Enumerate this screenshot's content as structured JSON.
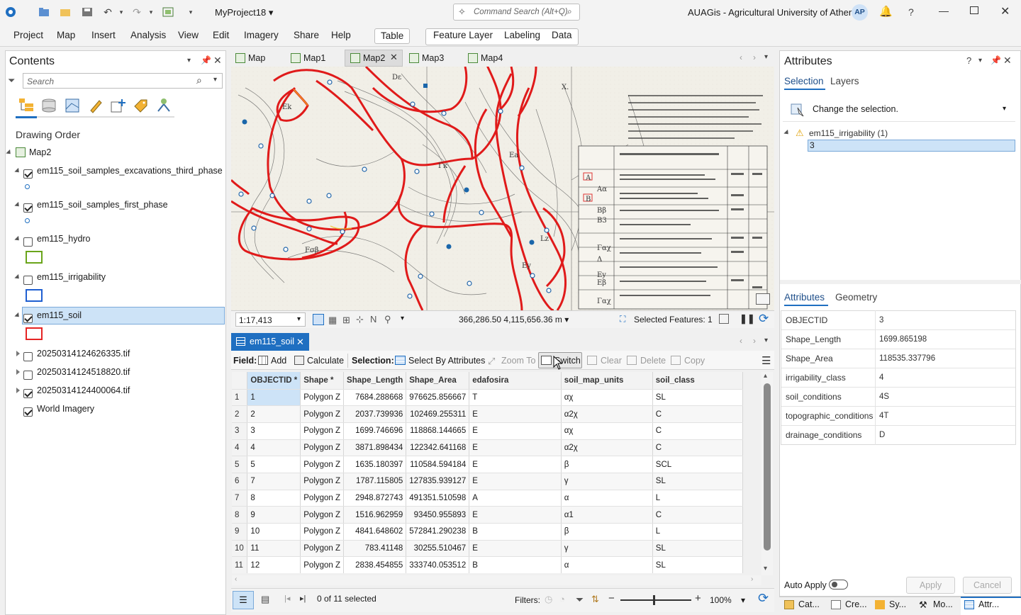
{
  "titlebar": {
    "project": "MyProject18",
    "command_search_placeholder": "Command Search (Alt+Q)",
    "org": "AUAGis - Agricultural University of Athens",
    "avatar": "AP"
  },
  "ribbon": {
    "tabs": [
      "Project",
      "Map",
      "Insert",
      "Analysis",
      "View",
      "Edit",
      "Imagery",
      "Share",
      "Help"
    ],
    "table_tab": "Table",
    "context_tabs": [
      "Feature Layer",
      "Labeling",
      "Data"
    ]
  },
  "contents": {
    "title": "Contents",
    "search_placeholder": "Search",
    "drawing_order": "Drawing Order",
    "map_name": "Map2",
    "layers": [
      {
        "name": "em115_soil_samples_excavations_third_phase",
        "checked": true,
        "symbol": "point"
      },
      {
        "name": "em115_soil_samples_first_phase",
        "checked": true,
        "symbol": "point"
      },
      {
        "name": "em115_hydro",
        "checked": false,
        "symbol": "green"
      },
      {
        "name": "em115_irrigability",
        "checked": false,
        "symbol": "blue"
      },
      {
        "name": "em115_soil",
        "checked": true,
        "symbol": "red"
      },
      {
        "name": "20250314124626335.tif",
        "checked": false
      },
      {
        "name": "20250314124518820.tif",
        "checked": false
      },
      {
        "name": "20250314124400064.tif",
        "checked": true
      },
      {
        "name": "World Imagery",
        "checked": true
      }
    ]
  },
  "map_tabs": [
    "Map",
    "Map1",
    "Map2",
    "Map3",
    "Map4"
  ],
  "map_status": {
    "scale": "1:17,413",
    "coords": "366,286.50 4,115,656.36 m",
    "selected": "Selected Features: 1"
  },
  "table": {
    "tab": "em115_soil",
    "field_label": "Field:",
    "add": "Add",
    "calculate": "Calculate",
    "selection_label": "Selection:",
    "select_by_attributes": "Select By Attributes",
    "zoom_to": "Zoom To",
    "switch": "Switch",
    "clear": "Clear",
    "delete": "Delete",
    "copy": "Copy",
    "columns": [
      "OBJECTID *",
      "Shape *",
      "Shape_Length",
      "Shape_Area",
      "edafosira",
      "soil_map_units",
      "soil_class"
    ],
    "rows": [
      [
        "1",
        "1",
        "Polygon Z",
        "7684.288668",
        "976625.856667",
        "T",
        "αχ",
        "SL"
      ],
      [
        "2",
        "2",
        "Polygon Z",
        "2037.739936",
        "102469.255311",
        "E",
        "α2χ",
        "C"
      ],
      [
        "3",
        "3",
        "Polygon Z",
        "1699.746696",
        "118868.144665",
        "E",
        "αχ",
        "C"
      ],
      [
        "4",
        "4",
        "Polygon Z",
        "3871.898434",
        "122342.641168",
        "E",
        "α2χ",
        "C"
      ],
      [
        "5",
        "5",
        "Polygon Z",
        "1635.180397",
        "110584.594184",
        "E",
        "β",
        "SCL"
      ],
      [
        "6",
        "7",
        "Polygon Z",
        "1787.115805",
        "127835.939127",
        "E",
        "γ",
        "SL"
      ],
      [
        "7",
        "8",
        "Polygon Z",
        "2948.872743",
        "491351.510598",
        "A",
        "α",
        "L"
      ],
      [
        "8",
        "9",
        "Polygon Z",
        "1516.962959",
        "93450.955893",
        "E",
        "α1",
        "C"
      ],
      [
        "9",
        "10",
        "Polygon Z",
        "4841.648602",
        "572841.290238",
        "B",
        "β",
        "L"
      ],
      [
        "10",
        "11",
        "Polygon Z",
        "783.41148",
        "30255.510467",
        "E",
        "γ",
        "SL"
      ],
      [
        "11",
        "12",
        "Polygon Z",
        "2838.454855",
        "333740.053512",
        "B",
        "α",
        "SL"
      ]
    ],
    "footer_status": "0 of 11 selected",
    "filters_label": "Filters:",
    "zoom": "100%"
  },
  "attributes": {
    "title": "Attributes",
    "tab_selection": "Selection",
    "tab_layers": "Layers",
    "change_selection": "Change the selection.",
    "tree_layer": "em115_irrigability (1)",
    "tree_item": "3",
    "tab_attributes": "Attributes",
    "tab_geometry": "Geometry",
    "fields": [
      {
        "k": "OBJECTID",
        "v": "3"
      },
      {
        "k": "Shape_Length",
        "v": "1699.865198"
      },
      {
        "k": "Shape_Area",
        "v": "118535.337796"
      },
      {
        "k": "irrigability_class",
        "v": "4"
      },
      {
        "k": "soil_conditions",
        "v": "4S"
      },
      {
        "k": "topographic_conditions",
        "v": "4T"
      },
      {
        "k": "drainage_conditions",
        "v": "D"
      }
    ],
    "auto_apply": "Auto Apply",
    "apply": "Apply",
    "cancel": "Cancel"
  },
  "bottom_tabs": [
    "Cat...",
    "Cre...",
    "Sy...",
    "Mo...",
    "Attr..."
  ]
}
